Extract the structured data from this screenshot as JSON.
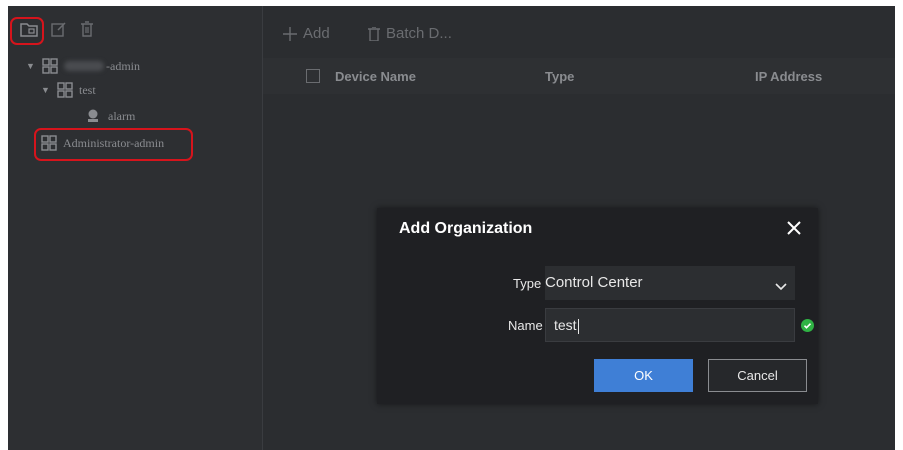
{
  "tree": {
    "root_label": "-admin",
    "child_label": "test",
    "grandchild_label": "alarm",
    "admin_label": "Administrator-admin"
  },
  "toolbar": {
    "add_label": "Add",
    "batch_delete_label": "Batch D..."
  },
  "table": {
    "columns": [
      "Device Name",
      "Type",
      "IP Address"
    ]
  },
  "dialog": {
    "title": "Add Organization",
    "type_label": "Type",
    "type_value": "Control Center",
    "name_label": "Name",
    "name_value": "test",
    "ok_label": "OK",
    "cancel_label": "Cancel"
  },
  "colors": {
    "accent": "#3f7fd6",
    "highlight": "#d6141c",
    "valid": "#2fb344"
  }
}
